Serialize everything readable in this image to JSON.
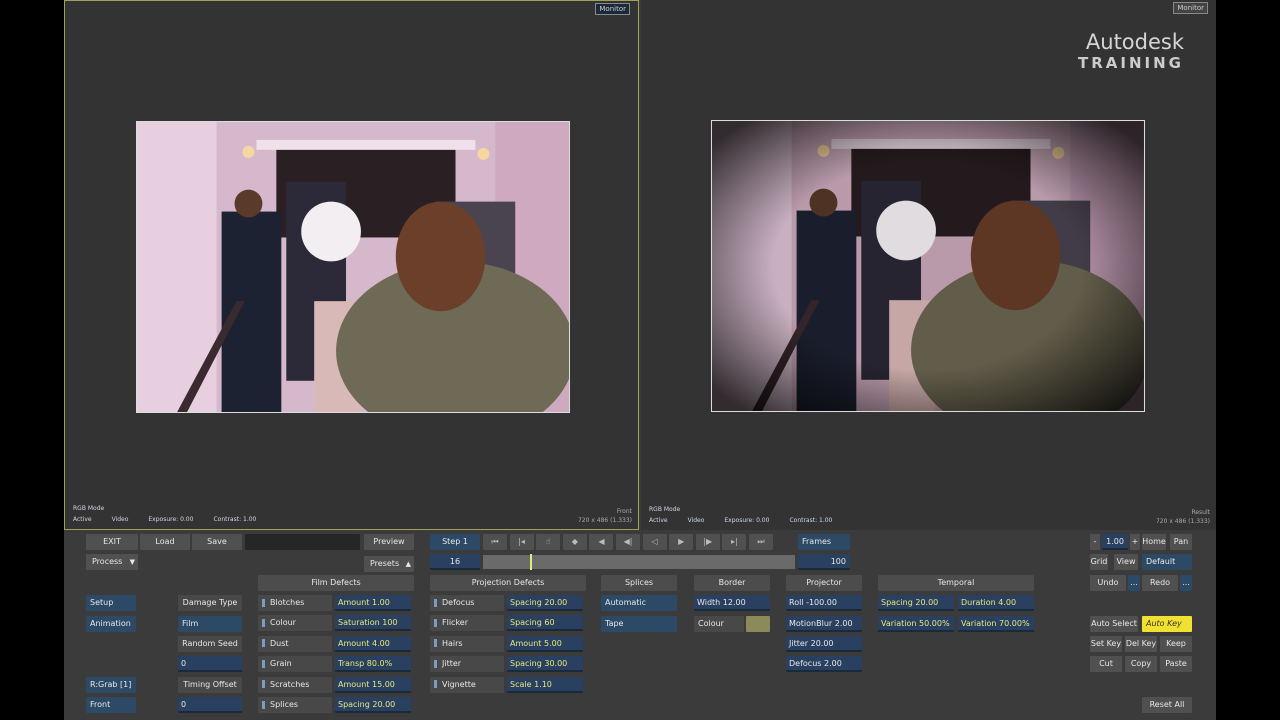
{
  "viewer_left": {
    "tag": "Monitor",
    "mode": "RGB Mode",
    "status": "Active",
    "video": "Video",
    "exposure": "Exposure: 0.00",
    "contrast": "Contrast: 1.00",
    "name": "Front",
    "res": "720 x 486 (1.333)"
  },
  "viewer_right": {
    "tag": "Monitor",
    "mode": "RGB Mode",
    "status": "Active",
    "video": "Video",
    "exposure": "Exposure: 0.00",
    "contrast": "Contrast: 1.00",
    "name": "Result",
    "res": "720 x 486 (1.333)"
  },
  "brand": {
    "line1": "Autodesk",
    "line2": "TRAINING"
  },
  "toolbar": {
    "exit": "EXIT",
    "load": "Load",
    "save": "Save",
    "preview": "Preview",
    "process": "Process",
    "presets": "Presets",
    "step": "Step 1",
    "frame": "16",
    "frames_label": "Frames",
    "frames_value": "100"
  },
  "view": {
    "minus": "-",
    "zoom": "1.00",
    "plus": "+",
    "home": "Home",
    "pan": "Pan",
    "grid": "Grid",
    "view": "View",
    "view_value": "Default",
    "undo": "Undo",
    "redo": "Redo",
    "more": "..."
  },
  "left_nav": {
    "setup": "Setup",
    "animation": "Animation",
    "rgrab": "R:Grab [1]",
    "front": "Front"
  },
  "damage": {
    "type_label": "Damage Type",
    "type_value": "Film",
    "seed_label": "Random Seed",
    "seed_value": "0",
    "offset_label": "Timing Offset",
    "offset_value": "0"
  },
  "film_defects": {
    "header": "Film Defects",
    "rows": [
      {
        "name": "Blotches",
        "value": "Amount 1.00"
      },
      {
        "name": "Colour",
        "value": "Saturation 100"
      },
      {
        "name": "Dust",
        "value": "Amount 4.00"
      },
      {
        "name": "Grain",
        "value": "Transp 80.0%"
      },
      {
        "name": "Scratches",
        "value": "Amount 15.00"
      },
      {
        "name": "Splices",
        "value": "Spacing 20.00"
      }
    ]
  },
  "projection_defects": {
    "header": "Projection Defects",
    "rows": [
      {
        "name": "Defocus",
        "value": "Spacing 20.00"
      },
      {
        "name": "Flicker",
        "value": "Spacing 60"
      },
      {
        "name": "Hairs",
        "value": "Amount 5.00"
      },
      {
        "name": "Jitter",
        "value": "Spacing 30.00"
      },
      {
        "name": "Vignette",
        "value": "Scale 1.10"
      }
    ]
  },
  "splices": {
    "header": "Splices",
    "a": "Automatic",
    "b": "Tape"
  },
  "border": {
    "header": "Border",
    "width": "Width 12.00",
    "colour": "Colour"
  },
  "projector": {
    "header": "Projector",
    "roll": "Roll -100.00",
    "motionblur": "MotionBlur 2.00",
    "jitter": "Jitter 20.00",
    "defocus": "Defocus 2.00"
  },
  "temporal": {
    "header": "Temporal",
    "spacing": "Spacing 20.00",
    "duration": "Duration 4.00",
    "variation1": "Variation 50.00%",
    "variation2": "Variation 70.00%"
  },
  "keys": {
    "auto_select": "Auto Select",
    "auto_key": "Auto Key",
    "set_key": "Set Key",
    "del_key": "Del Key",
    "keep": "Keep",
    "cut": "Cut",
    "copy": "Copy",
    "paste": "Paste",
    "reset_all": "Reset All"
  },
  "transport_icons": [
    "to-start-icon",
    "prev-key-icon",
    "cursor-icon",
    "set-mark-icon",
    "prev-frame-icon",
    "step-back-icon",
    "play-back-icon",
    "play-icon",
    "step-fwd-icon",
    "next-key-icon",
    "to-end-icon"
  ],
  "colors": {
    "border_swatch": "#8a8a5a",
    "accent_yellow": "#f2e030",
    "field_blue": "#2a4060"
  }
}
